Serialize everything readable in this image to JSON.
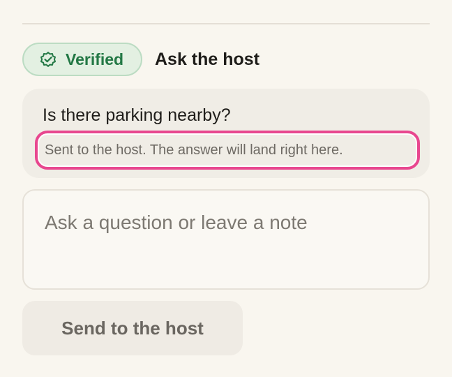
{
  "badge": {
    "label": "Verified",
    "icon": "verified-check-icon",
    "color": "#237845",
    "background": "#e3f0e2"
  },
  "section": {
    "title": "Ask the host"
  },
  "message": {
    "text": "Is there parking nearby?",
    "status": "Sent to the host. The answer will land right here.",
    "highlight_color": "#e8478f"
  },
  "composer": {
    "placeholder": "Ask a question or leave a note",
    "value": ""
  },
  "send_button": {
    "label": "Send to the host"
  }
}
